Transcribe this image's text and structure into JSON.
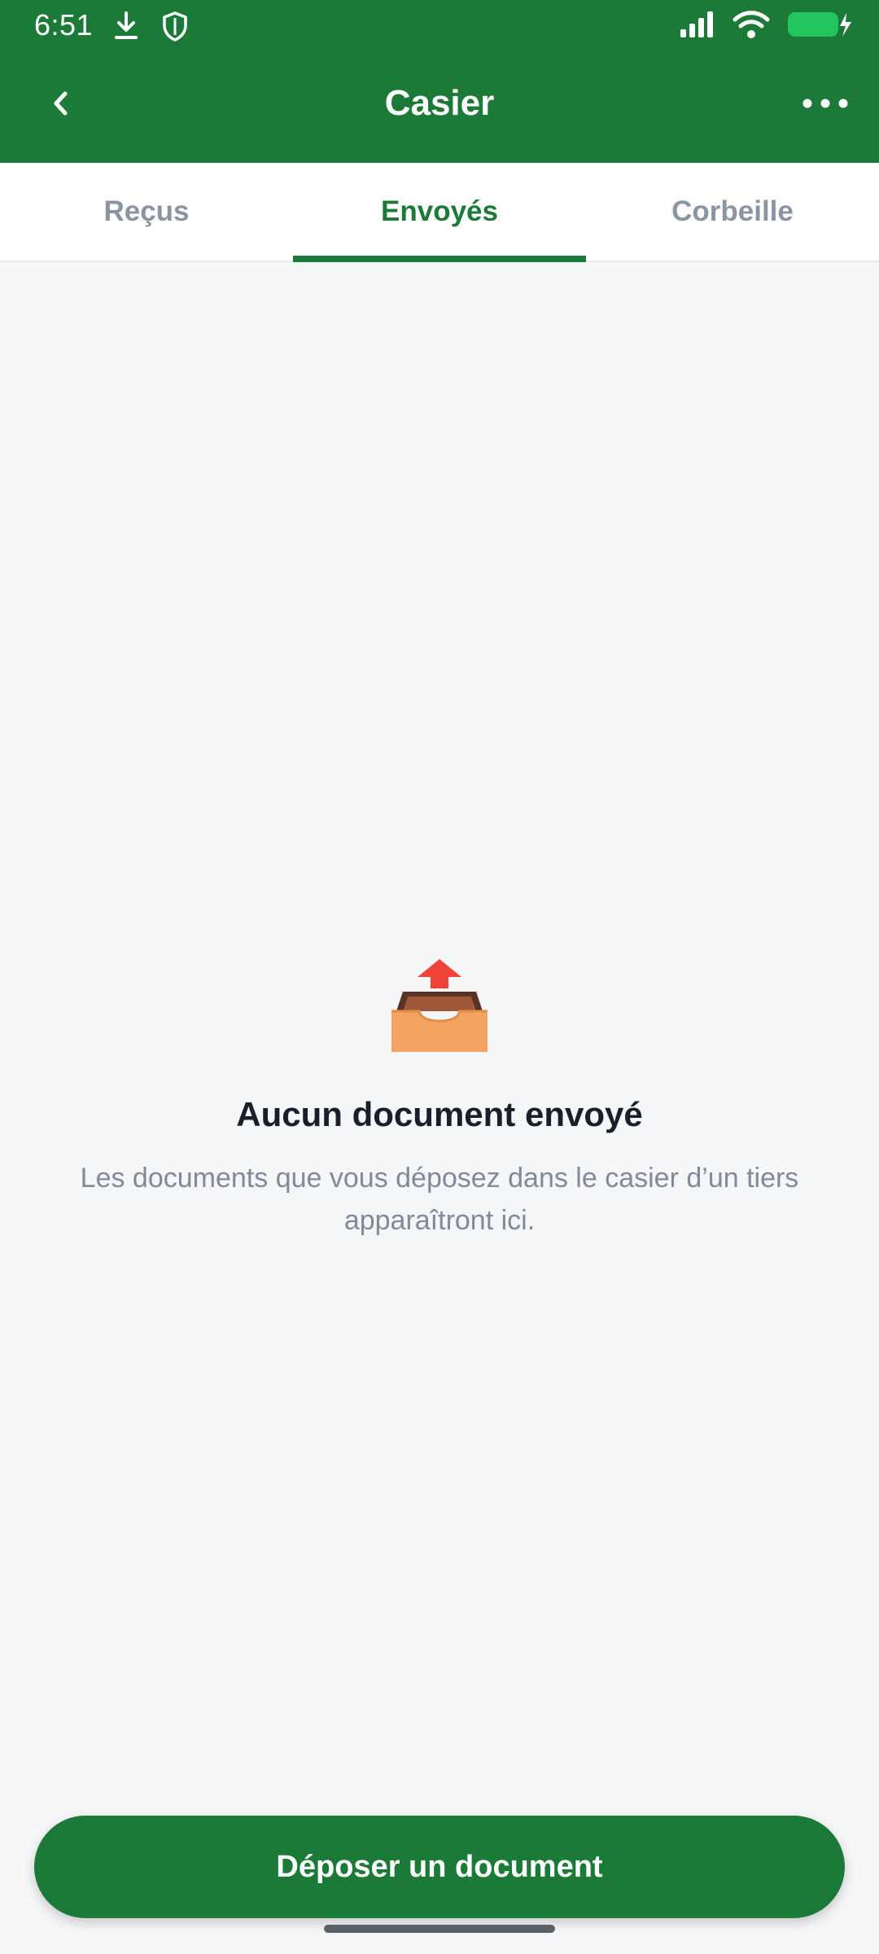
{
  "status_bar": {
    "time": "6:51",
    "icons": [
      "download-icon",
      "shield-icon",
      "signal-icon",
      "wifi-icon",
      "battery-charging-icon"
    ],
    "battery_color": "#22c55e"
  },
  "header": {
    "title": "Casier",
    "back_icon": "chevron-left-icon",
    "menu_icon": "more-horizontal-icon"
  },
  "tabs": [
    {
      "label": "Reçus",
      "active": false
    },
    {
      "label": "Envoyés",
      "active": true
    },
    {
      "label": "Corbeille",
      "active": false
    }
  ],
  "empty_state": {
    "icon": "outbox-tray-icon",
    "title": "Aucun document envoyé",
    "description": "Les documents que vous déposez dans le casier d’un tiers apparaîtront ici."
  },
  "primary_action": {
    "label": "Déposer un document"
  },
  "colors": {
    "brand_green": "#1b7a38",
    "background": "#f5f6f8",
    "tab_inactive": "#8a94a3",
    "text_dark": "#1a1f2b",
    "text_muted": "#808a99"
  }
}
